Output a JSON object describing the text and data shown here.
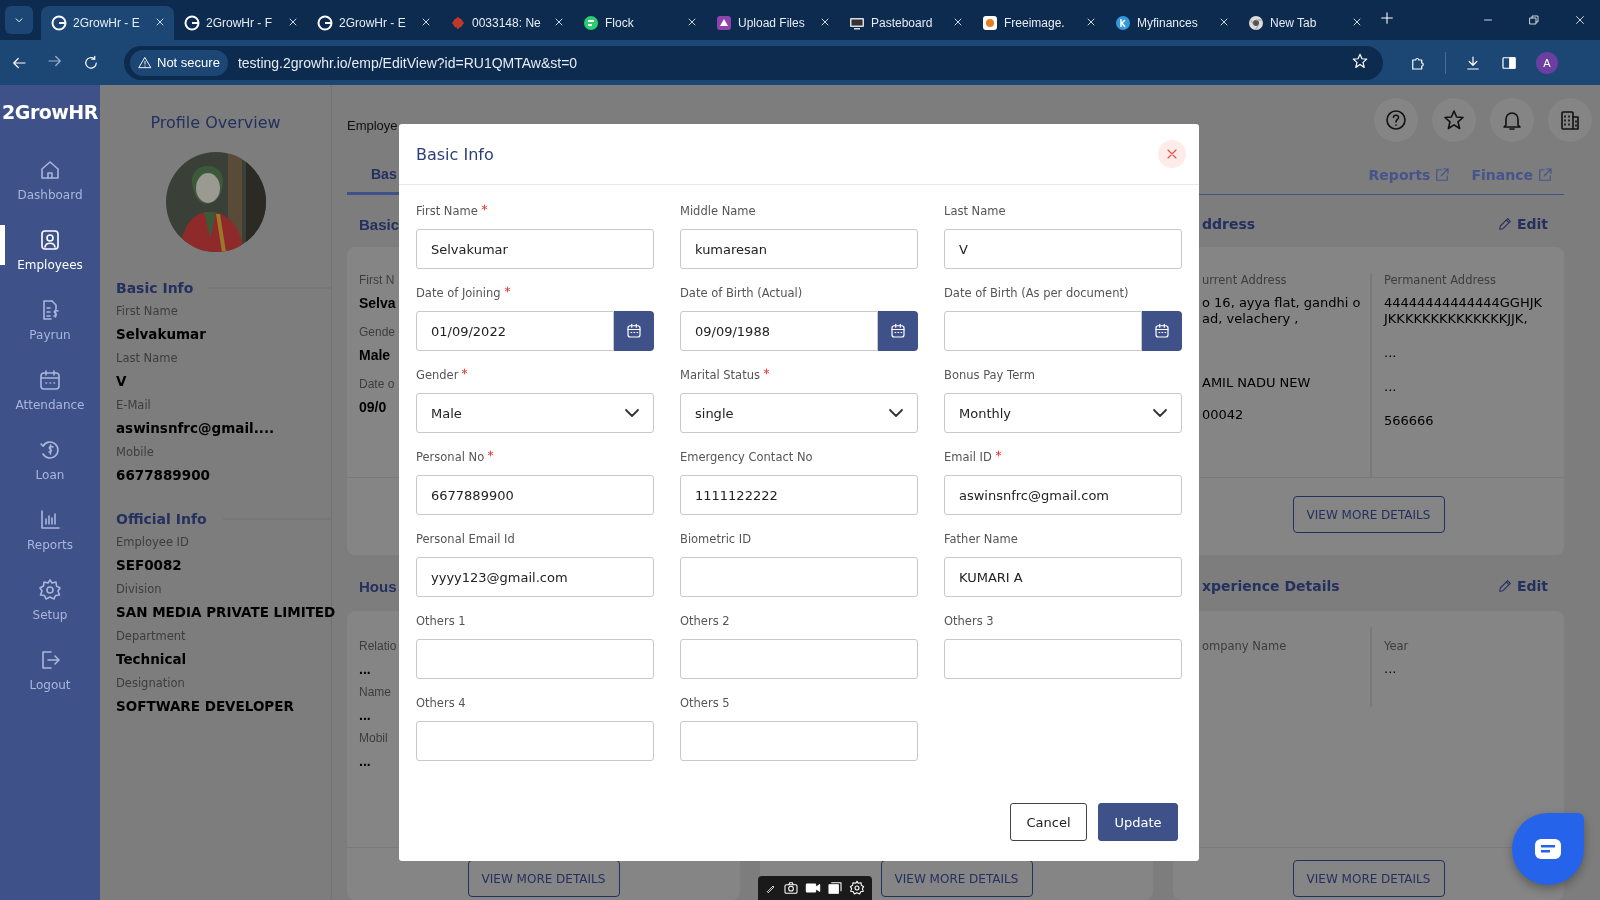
{
  "browser": {
    "tabs": [
      {
        "title": "2GrowHr - E",
        "kind": "growhr",
        "selected": true
      },
      {
        "title": "2GrowHr - F",
        "kind": "growhr",
        "selected": false
      },
      {
        "title": "2GrowHr - E",
        "kind": "growhr",
        "selected": false
      },
      {
        "title": "0033148: Ne",
        "kind": "bug",
        "selected": false
      },
      {
        "title": "Flock",
        "kind": "flock",
        "selected": false
      },
      {
        "title": "Upload Files",
        "kind": "upload",
        "selected": false
      },
      {
        "title": "Pasteboard",
        "kind": "monitor",
        "selected": false
      },
      {
        "title": "Freeimage.",
        "selected": false
      },
      {
        "title": "Myfinances",
        "kind": "finance",
        "selected": false
      },
      {
        "title": "New Tab",
        "kind": "chrome",
        "selected": false
      }
    ],
    "security": "Not secure",
    "url": "testing.2growhr.io/emp/EditView?id=RU1QMTAw&st=0",
    "profile_initial": "A"
  },
  "sidebar": {
    "logo": "2GrowHR",
    "items": [
      {
        "label": "Dashboard",
        "kind": "home",
        "selected": false
      },
      {
        "label": "Employees",
        "kind": "user",
        "selected": true
      },
      {
        "label": "Payrun",
        "kind": "payroll",
        "selected": false
      },
      {
        "label": "Attendance",
        "kind": "calendar",
        "selected": false
      },
      {
        "label": "Loan",
        "kind": "loan",
        "selected": false
      },
      {
        "label": "Reports",
        "kind": "chart",
        "selected": false
      },
      {
        "label": "Setup",
        "kind": "gear",
        "selected": false
      },
      {
        "label": "Logout",
        "kind": "logout",
        "selected": false
      }
    ]
  },
  "profile": {
    "title": "Profile Overview",
    "sections": [
      {
        "heading": "Basic Info",
        "fields": [
          {
            "label": "First Name",
            "value": "Selvakumar"
          },
          {
            "label": "Last Name",
            "value": "V"
          },
          {
            "label": "E-Mail",
            "value": "aswinsnfrc@gmail...."
          },
          {
            "label": "Mobile",
            "value": "6677889900"
          }
        ]
      },
      {
        "heading": "Official Info",
        "fields": [
          {
            "label": "Employee ID",
            "value": "SEF0082"
          },
          {
            "label": "Division",
            "value": "SAN MEDIA PRIVATE LIMITED"
          },
          {
            "label": "Department",
            "value": "Technical"
          },
          {
            "label": "Designation",
            "value": "SOFTWARE DEVELOPER"
          }
        ]
      }
    ]
  },
  "page": {
    "breadcrumb": "Employe",
    "tabs": [
      {
        "label": "Bas",
        "selected": true
      }
    ],
    "links": [
      "Reports",
      "Finance"
    ],
    "columns": [
      {
        "heading": "Basic",
        "card": {
          "fields": [
            {
              "label": "First N",
              "value": "Selva"
            },
            {
              "label": "Gende",
              "value": "Male"
            },
            {
              "label": "Date o",
              "value": "09/0"
            }
          ]
        },
        "heading_2": "Hous",
        "card_2": {
          "fields": [
            {
              "label": "Relatio",
              "value": "..."
            },
            {
              "label": "Name",
              "value": "..."
            },
            {
              "label": "Mobil",
              "value": "..."
            }
          ],
          "button": "VIEW MORE DETAILS"
        }
      },
      {
        "card_2": {
          "button": "VIEW MORE DETAILS"
        }
      },
      {
        "heading": "ddress",
        "edit": "Edit",
        "card": {
          "subcolumns": [
            {
              "label": "urrent Address",
              "values": [
                "o 16, ayya flat, gandhi oad, velachery ,",
                "AMIL NADU NEW",
                "00042"
              ]
            },
            {
              "label": "Permanent Address",
              "values": [
                "44444444444444GGHJKJKKKKKKKKKKKKKKJJK,",
                "...",
                "...",
                "566666"
              ]
            }
          ],
          "button": "VIEW MORE DETAILS"
        },
        "heading_2": "xperience Details",
        "edit_2": "Edit",
        "card_2": {
          "subcolumns": [
            {
              "label": "ompany Name"
            },
            {
              "label": "Year",
              "values": [
                "..."
              ]
            }
          ],
          "button": "VIEW MORE DETAILS"
        }
      }
    ]
  },
  "modal": {
    "title": "Basic Info",
    "fields": [
      {
        "label": "First Name",
        "required": true,
        "kind": "text",
        "value": "Selvakumar"
      },
      {
        "label": "Middle Name",
        "required": false,
        "kind": "text",
        "value": "kumaresan"
      },
      {
        "label": "Last Name",
        "required": false,
        "kind": "text",
        "value": "V"
      },
      {
        "label": "Date of Joining",
        "required": true,
        "kind": "date",
        "value": "01/09/2022"
      },
      {
        "label": "Date of Birth (Actual)",
        "required": false,
        "kind": "date",
        "value": "09/09/1988"
      },
      {
        "label": "Date of Birth (As per document)",
        "required": false,
        "kind": "date"
      },
      {
        "label": "Gender",
        "required": true,
        "kind": "select",
        "value": "Male"
      },
      {
        "label": "Marital Status",
        "required": true,
        "kind": "select",
        "value": "single"
      },
      {
        "label": "Bonus Pay Term",
        "required": false,
        "kind": "select",
        "value": "Monthly"
      },
      {
        "label": "Personal No",
        "required": true,
        "kind": "text",
        "value": "6677889900"
      },
      {
        "label": "Emergency Contact No",
        "required": false,
        "kind": "text",
        "value": "1111122222"
      },
      {
        "label": "Email ID",
        "required": true,
        "kind": "text",
        "value": "aswinsnfrc@gmail.com"
      },
      {
        "label": "Personal Email Id",
        "required": false,
        "kind": "text",
        "value": "yyyy123@gmail.com"
      },
      {
        "label": "Biometric ID",
        "required": false,
        "kind": "text"
      },
      {
        "label": "Father Name",
        "required": false,
        "kind": "text",
        "value": "KUMARI A"
      },
      {
        "label": "Others 1",
        "required": false,
        "kind": "text"
      },
      {
        "label": "Others 2",
        "required": false,
        "kind": "text"
      },
      {
        "label": "Others 3",
        "required": false,
        "kind": "text"
      },
      {
        "label": "Others 4",
        "required": false,
        "kind": "text"
      },
      {
        "label": "Others 5",
        "required": false,
        "kind": "text"
      }
    ],
    "buttons": [
      {
        "label": "Cancel",
        "kind": "secondary"
      },
      {
        "label": "Update",
        "kind": "primary"
      }
    ]
  }
}
